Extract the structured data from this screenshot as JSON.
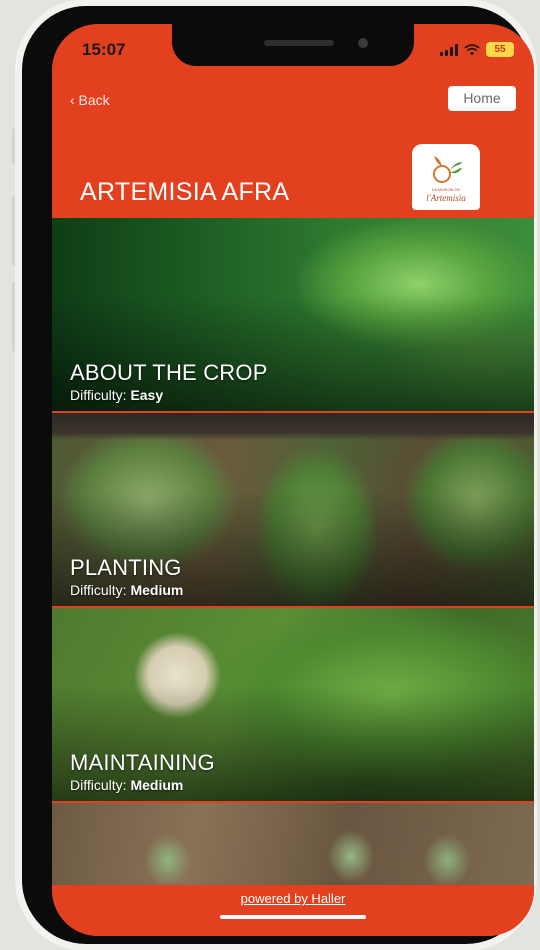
{
  "status_bar": {
    "time": "15:07",
    "battery": "55",
    "wifi_icon": "wifi-icon",
    "signal_icon": "signal-icon"
  },
  "header": {
    "back_label": "‹  Back",
    "home_label": "Home",
    "title": "ARTEMISIA AFRA",
    "logo_small_text": "LA MAISON DE",
    "logo_text": "l'Artemisia",
    "colors": {
      "header_bg": "#e2401f",
      "text": "#ffffff"
    }
  },
  "sections": [
    {
      "title": "ABOUT THE CROP",
      "difficulty_label": "Difficulty:",
      "difficulty": "Easy"
    },
    {
      "title": "PLANTING",
      "difficulty_label": "Difficulty:",
      "difficulty": "Medium"
    },
    {
      "title": "MAINTAINING",
      "difficulty_label": "Difficulty:",
      "difficulty": "Medium"
    }
  ],
  "footer": {
    "powered_by": "powered by Haller"
  }
}
